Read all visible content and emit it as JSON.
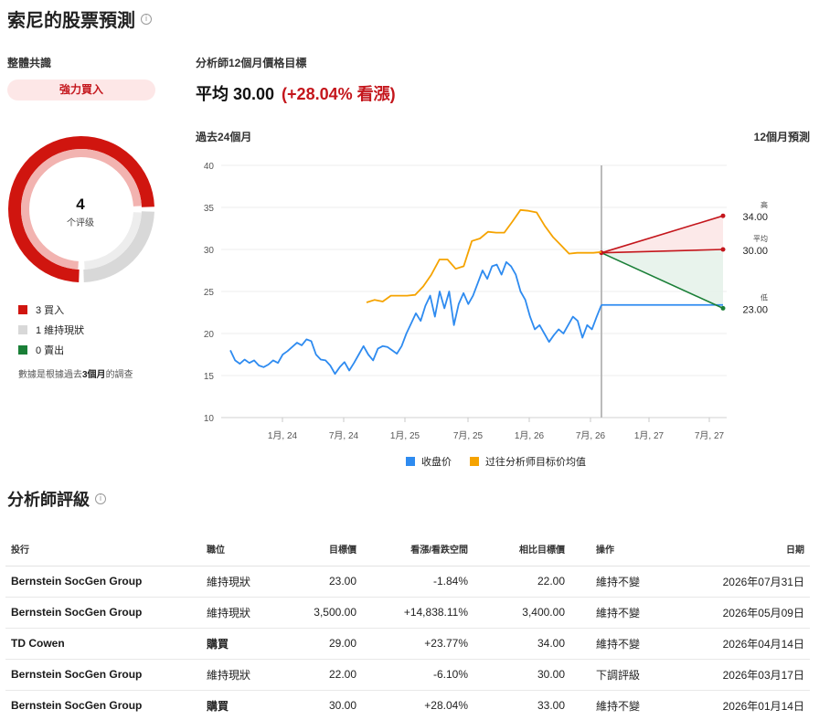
{
  "title": "索尼的股票預測",
  "consensus": {
    "label": "整體共識",
    "rating": "強力買入",
    "count": "4",
    "count_label": "个评级",
    "buy": 3,
    "hold": 1,
    "sell": 0,
    "legend": [
      {
        "label": "3 買入",
        "color": "#d0150f"
      },
      {
        "label": "1 維持現狀",
        "color": "#d8d8d8"
      },
      {
        "label": "0 賣出",
        "color": "#1a7f37"
      }
    ],
    "note_prefix": "數據是根據過去",
    "note_period": "3個月",
    "note_suffix": "的調查"
  },
  "target": {
    "label": "分析師12個月價格目標",
    "average_text": "平均 30.00",
    "change_text": "(+28.04% 看漲)",
    "high_label": "高",
    "high_value": "34.00",
    "avg_label": "平均",
    "avg_value": "30.00",
    "low_label": "低",
    "low_value": "23.00"
  },
  "chart_labels": {
    "past": "過去24個月",
    "future": "12個月預測"
  },
  "colors": {
    "close": "#2e8bf0",
    "target_avg": "#f5a300",
    "high": "#c4161c",
    "low": "#1a7f37",
    "divider": "#bbbbbb"
  },
  "chart_data": {
    "type": "line",
    "ylim": [
      10,
      40
    ],
    "yticks": [
      "40",
      "35",
      "30",
      "25",
      "20",
      "15",
      "10"
    ],
    "xticks": [
      "1月, 24",
      "7月, 24",
      "1月, 25",
      "7月, 25",
      "1月, 26",
      "7月, 26",
      "1月, 27",
      "7月, 27"
    ],
    "series": [
      {
        "name": "收盘价",
        "color": "#2e8bf0",
        "values": [
          18.0,
          16.8,
          16.4,
          16.9,
          16.5,
          16.8,
          16.2,
          16.0,
          16.3,
          16.8,
          16.5,
          17.5,
          17.9,
          18.4,
          18.9,
          18.6,
          19.3,
          19.1,
          17.5,
          16.9,
          16.8,
          16.2,
          15.2,
          16.0,
          16.6,
          15.6,
          16.5,
          17.5,
          18.5,
          17.5,
          16.8,
          18.2,
          18.5,
          18.4,
          18.0,
          17.6,
          18.5,
          20.0,
          21.2,
          22.4,
          21.5,
          23.3,
          24.5,
          22.0,
          25.0,
          23.0,
          25.0,
          21.0,
          23.5,
          24.8,
          23.5,
          24.5,
          26.0,
          27.5,
          26.5,
          28.0,
          28.2,
          27.0,
          28.5,
          28.0,
          27.0,
          25.0,
          24.0,
          22.0,
          20.5,
          21.0,
          20.0,
          19.0,
          19.8,
          20.5,
          20.0,
          21.0,
          22.0,
          21.5,
          19.5,
          21.0,
          20.5,
          22.0,
          23.4
        ]
      },
      {
        "name": "过往分析师目标价均值",
        "color": "#f5a300",
        "values": [
          23.7,
          24.0,
          23.8,
          24.5,
          24.5,
          24.5,
          24.6,
          25.6,
          27.0,
          28.8,
          28.8,
          27.7,
          28.0,
          31.0,
          31.3,
          32.1,
          32.0,
          32.0,
          33.3,
          34.7,
          34.6,
          34.4,
          32.8,
          31.5,
          30.5,
          29.5,
          29.6,
          29.6,
          29.6,
          29.7
        ]
      }
    ],
    "forecast": {
      "start": 29.6,
      "high": 34.0,
      "average": 30.0,
      "low": 23.0,
      "current_close": 23.4
    }
  },
  "ratings": {
    "title": "分析師評級",
    "columns": [
      "投行",
      "職位",
      "目標價",
      "看漲/看跌空間",
      "相比目標價",
      "操作",
      "日期"
    ],
    "rows": [
      {
        "firm": "Bernstein SocGen Group",
        "position": "維持現狀",
        "position_type": "hold",
        "target": "23.00",
        "upside": "-1.84%",
        "upside_type": "neg",
        "previous": "22.00",
        "action": "維持不變",
        "date": "2026年07月31日"
      },
      {
        "firm": "Bernstein SocGen Group",
        "position": "維持現狀",
        "position_type": "hold",
        "target": "3,500.00",
        "upside": "+14,838.11%",
        "upside_type": "pos",
        "previous": "3,400.00",
        "action": "維持不變",
        "date": "2026年05月09日"
      },
      {
        "firm": "TD Cowen",
        "position": "購買",
        "position_type": "buy",
        "target": "29.00",
        "upside": "+23.77%",
        "upside_type": "pos",
        "previous": "34.00",
        "action": "維持不變",
        "date": "2026年04月14日"
      },
      {
        "firm": "Bernstein SocGen Group",
        "position": "維持現狀",
        "position_type": "hold",
        "target": "22.00",
        "upside": "-6.10%",
        "upside_type": "neg",
        "previous": "30.00",
        "action": "下調評級",
        "date": "2026年03月17日"
      },
      {
        "firm": "Bernstein SocGen Group",
        "position": "購買",
        "position_type": "buy",
        "target": "30.00",
        "upside": "+28.04%",
        "upside_type": "pos",
        "previous": "33.00",
        "action": "維持不變",
        "date": "2026年01月14日"
      }
    ]
  }
}
